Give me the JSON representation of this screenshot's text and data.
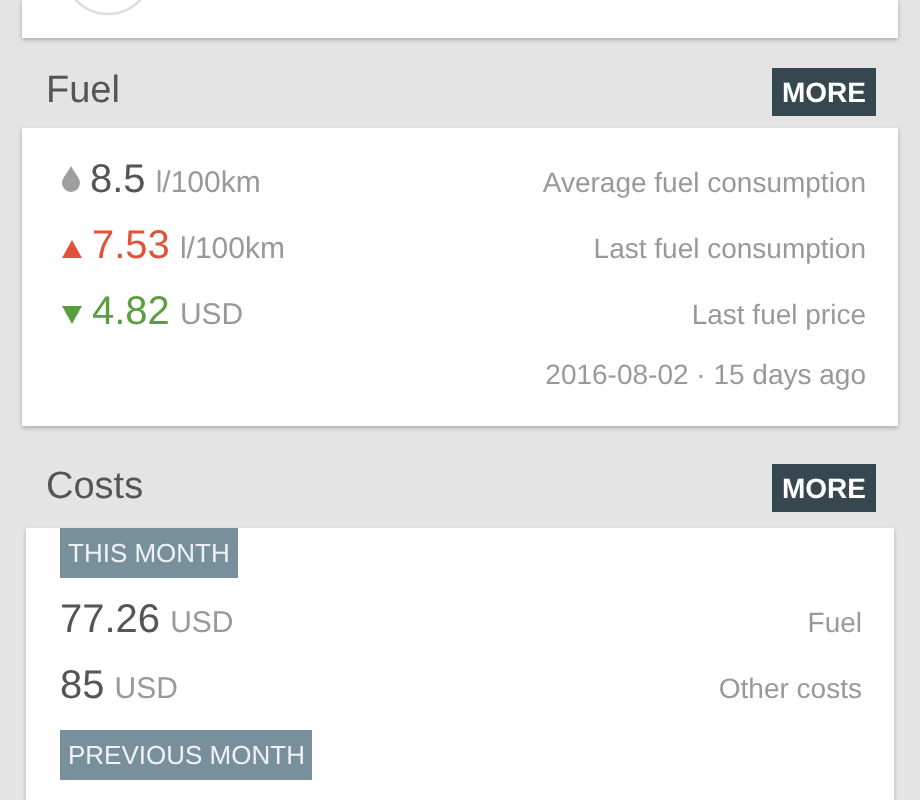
{
  "fuel": {
    "title": "Fuel",
    "button": "MORE",
    "rows": [
      {
        "kind": "average",
        "value": "8.5",
        "unit": "l/100km",
        "label": "Average fuel consumption"
      },
      {
        "kind": "up",
        "value": "7.53",
        "unit": "l/100km",
        "label": "Last fuel consumption"
      },
      {
        "kind": "down",
        "value": "4.82",
        "unit": "USD",
        "label": "Last fuel price"
      }
    ],
    "footnote": "2016-08-02 · 15 days ago"
  },
  "costs": {
    "title": "Costs",
    "button": "MORE",
    "groups": [
      {
        "tag": "THIS MONTH",
        "rows": [
          {
            "value": "77.26",
            "unit": "USD",
            "label": "Fuel"
          },
          {
            "value": "85",
            "unit": "USD",
            "label": "Other costs"
          }
        ]
      },
      {
        "tag": "PREVIOUS MONTH"
      }
    ]
  }
}
